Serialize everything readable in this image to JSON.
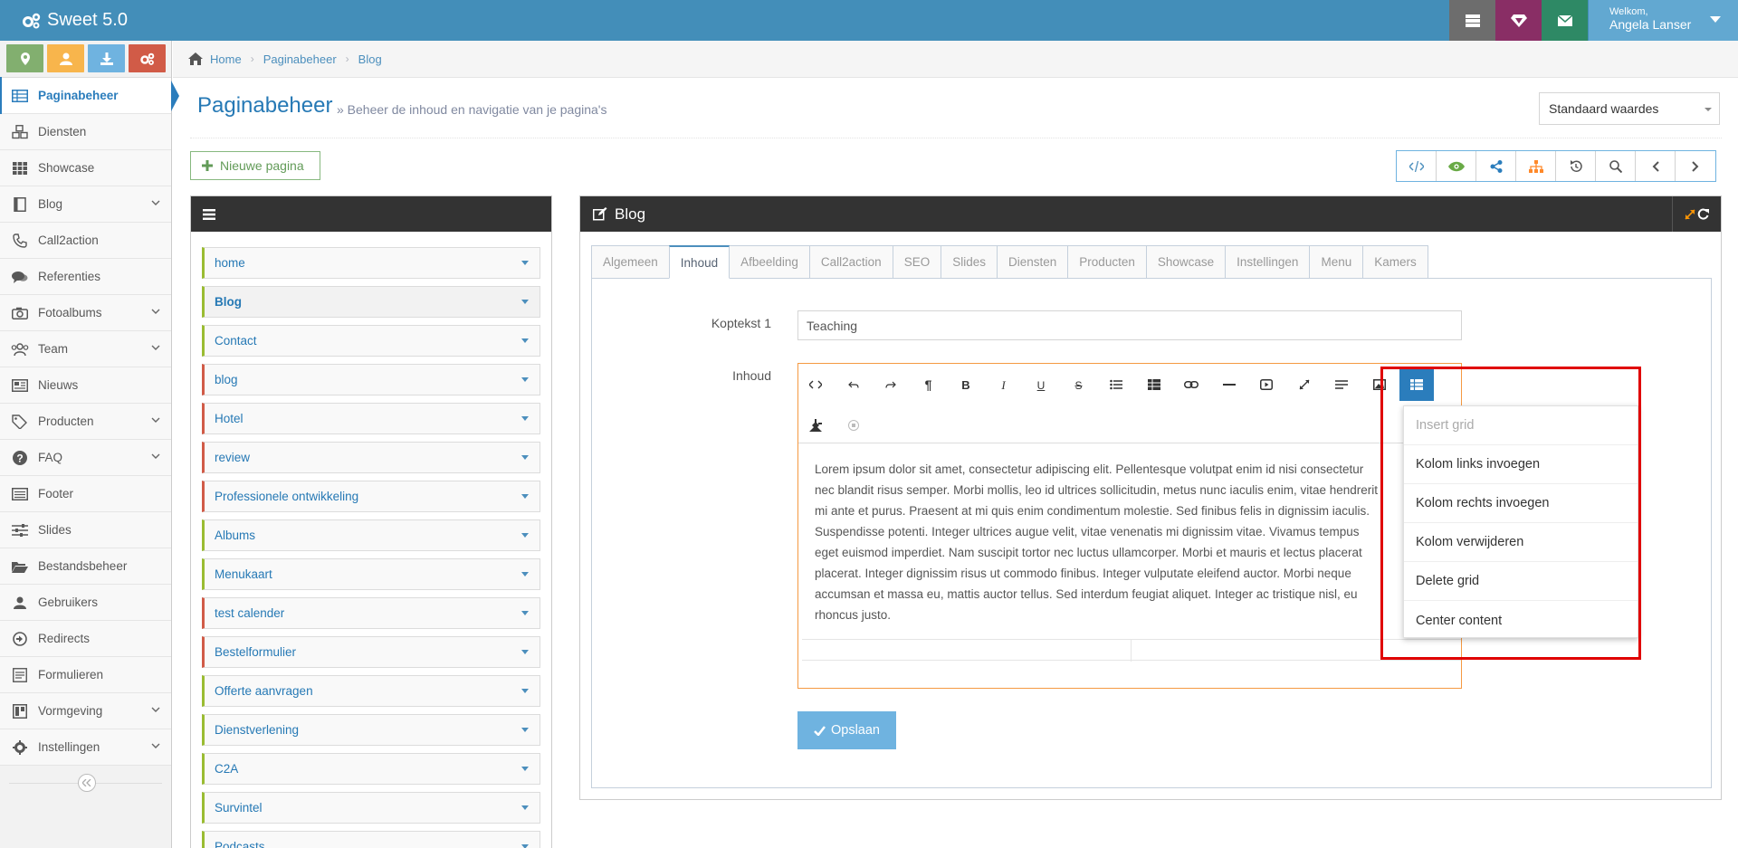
{
  "app": {
    "title": "Sweet 5.0"
  },
  "topbar": {
    "welcome_label": "Welkom,",
    "user_name": "Angela Lanser",
    "buttons": [
      {
        "name": "tasks",
        "icon": "tasks-icon",
        "color": "#6d6d6d"
      },
      {
        "name": "notifications",
        "icon": "diamond-icon",
        "color": "#892e65"
      },
      {
        "name": "messages",
        "icon": "envelope-icon",
        "color": "#2e8965"
      }
    ]
  },
  "shortcuts": [
    {
      "icon": "map-marker-icon",
      "color": "#82af6f"
    },
    {
      "icon": "user-icon",
      "color": "#f8b54c"
    },
    {
      "icon": "download-icon",
      "color": "#6fb3e0"
    },
    {
      "icon": "cogs-icon",
      "color": "#d15b47"
    }
  ],
  "sidebar": {
    "items": [
      {
        "label": "Paginabeheer",
        "icon": "table-icon",
        "active": true,
        "submenu": false
      },
      {
        "label": "Diensten",
        "icon": "cubes-icon",
        "active": false,
        "submenu": false
      },
      {
        "label": "Showcase",
        "icon": "grid-icon",
        "active": false,
        "submenu": false
      },
      {
        "label": "Blog",
        "icon": "book-icon",
        "active": false,
        "submenu": true
      },
      {
        "label": "Call2action",
        "icon": "phone-icon",
        "active": false,
        "submenu": false
      },
      {
        "label": "Referenties",
        "icon": "comments-icon",
        "active": false,
        "submenu": false
      },
      {
        "label": "Fotoalbums",
        "icon": "camera-icon",
        "active": false,
        "submenu": true
      },
      {
        "label": "Team",
        "icon": "users-icon",
        "active": false,
        "submenu": true
      },
      {
        "label": "Nieuws",
        "icon": "newspaper-icon",
        "active": false,
        "submenu": false
      },
      {
        "label": "Producten",
        "icon": "tags-icon",
        "active": false,
        "submenu": true
      },
      {
        "label": "FAQ",
        "icon": "question-icon",
        "active": false,
        "submenu": true
      },
      {
        "label": "Footer",
        "icon": "list-alt-icon",
        "active": false,
        "submenu": false
      },
      {
        "label": "Slides",
        "icon": "sliders-icon",
        "active": false,
        "submenu": false
      },
      {
        "label": "Bestandsbeheer",
        "icon": "folder-open-icon",
        "active": false,
        "submenu": false
      },
      {
        "label": "Gebruikers",
        "icon": "user-icon",
        "active": false,
        "submenu": false
      },
      {
        "label": "Redirects",
        "icon": "arrow-circle-icon",
        "active": false,
        "submenu": false
      },
      {
        "label": "Formulieren",
        "icon": "form-icon",
        "active": false,
        "submenu": false
      },
      {
        "label": "Vormgeving",
        "icon": "layout-icon",
        "active": false,
        "submenu": true
      },
      {
        "label": "Instellingen",
        "icon": "gear-icon",
        "active": false,
        "submenu": true
      }
    ]
  },
  "breadcrumb": [
    "Home",
    "Paginabeheer",
    "Blog"
  ],
  "page": {
    "title": "Paginabeheer",
    "subtitle": "» Beheer de inhoud en navigatie van je pagina's",
    "defaults_select": "Standaard waardes",
    "new_page_label": "Nieuwe pagina"
  },
  "toolbar_right": [
    {
      "icon": "code-icon",
      "color": "#4c8fbd"
    },
    {
      "icon": "eye-icon",
      "color": "#69aa46"
    },
    {
      "icon": "share-icon",
      "color": "#2b7dbc"
    },
    {
      "icon": "sitemap-icon",
      "color": "#ff892a"
    },
    {
      "icon": "history-icon",
      "color": "#555555"
    },
    {
      "icon": "search-icon",
      "color": "#555555"
    },
    {
      "icon": "chevron-left-icon",
      "color": "#555555"
    },
    {
      "icon": "chevron-right-icon",
      "color": "#555555"
    }
  ],
  "tree": {
    "items": [
      {
        "label": "home",
        "color": "#9abc32",
        "active": false
      },
      {
        "label": "Blog",
        "color": "#9abc32",
        "active": true
      },
      {
        "label": "Contact",
        "color": "#9abc32",
        "active": false
      },
      {
        "label": "blog",
        "color": "#d15b47",
        "active": false
      },
      {
        "label": "Hotel",
        "color": "#d15b47",
        "active": false
      },
      {
        "label": "review",
        "color": "#d15b47",
        "active": false
      },
      {
        "label": "Professionele ontwikkeling",
        "color": "#d15b47",
        "active": false
      },
      {
        "label": "Albums",
        "color": "#9abc32",
        "active": false
      },
      {
        "label": "Menukaart",
        "color": "#9abc32",
        "active": false
      },
      {
        "label": "test calender",
        "color": "#d15b47",
        "active": false
      },
      {
        "label": "Bestelformulier",
        "color": "#d15b47",
        "active": false
      },
      {
        "label": "Offerte aanvragen",
        "color": "#9abc32",
        "active": false
      },
      {
        "label": "Dienstverlening",
        "color": "#9abc32",
        "active": false
      },
      {
        "label": "C2A",
        "color": "#9abc32",
        "active": false
      },
      {
        "label": "Survintel",
        "color": "#9abc32",
        "active": false
      },
      {
        "label": "Podcasts",
        "color": "#9abc32",
        "active": false
      }
    ]
  },
  "editor": {
    "title": "Blog",
    "tabs": [
      "Algemeen",
      "Inhoud",
      "Afbeelding",
      "Call2action",
      "SEO",
      "Slides",
      "Diensten",
      "Producten",
      "Showcase",
      "Instellingen",
      "Menu",
      "Kamers"
    ],
    "active_tab": "Inhoud",
    "koptekst_label": "Koptekst 1",
    "koptekst_value": "Teaching",
    "inhoud_label": "Inhoud",
    "toolbar_buttons": [
      "code-view-icon",
      "undo-icon",
      "redo-icon",
      "paragraph-icon",
      "bold-icon",
      "italic-icon",
      "underline-icon",
      "strikethrough-icon",
      "unordered-list-icon",
      "table-icon",
      "link-icon",
      "horizontal-rule-icon",
      "video-icon",
      "fullscreen-icon",
      "align-icon",
      "image-icon",
      "grid-icon",
      "plugin-icon",
      "stop-icon"
    ],
    "body_lines": [
      "Lorem ipsum dolor sit amet, consectetur adipiscing elit. Pellentesque volutpat enim id nisi consectetur",
      "nec blandit risus semper. Morbi mollis, leo id ultrices sollicitudin, metus nunc iaculis enim, vitae hendrerit",
      "mi ante et purus. Praesent at mi quis enim condimentum molestie. Sed finibus felis in dignissim iaculis.",
      "Suspendisse potenti. Integer ultrices augue velit, vitae venenatis mi dignissim vitae. Vivamus tempus",
      "eget euismod imperdiet. Nam suscipit tortor nec luctus ullamcorper. Morbi et mauris et lectus placerat",
      "placerat. Integer dignissim risus ut commodo finibus. Integer vulputate eleifend auctor. Morbi neque",
      "accumsan et massa eu, mattis auctor tellus. Sed interdum feugiat aliquet. Integer ac tristique nisl, eu",
      "rhoncus justo."
    ],
    "grid_dropdown": {
      "header": "Insert grid",
      "items": [
        "Kolom links invoegen",
        "Kolom rechts invoegen",
        "Kolom verwijderen",
        "Delete grid",
        "Center content"
      ]
    },
    "save_label": "Opslaan"
  }
}
